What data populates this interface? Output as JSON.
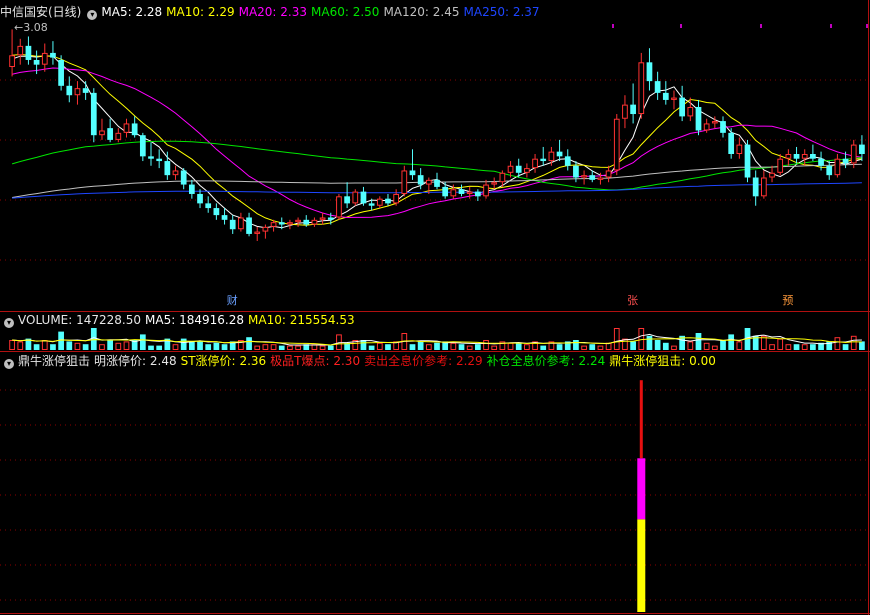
{
  "colors": {
    "background": "#000000",
    "up": "#ff3232",
    "down": "#54ffff",
    "grid": "#8b0000",
    "ma5": "#ffffff",
    "ma10": "#ffff00",
    "ma20": "#ff00ff",
    "ma60": "#00e600",
    "ma120": "#c0c0c0",
    "ma250": "#1e46ff"
  },
  "main": {
    "title": "中信国安(日线)",
    "legend_icon": "chevron-down-icon",
    "ma5_label": "MA5:",
    "ma5_value": "2.28",
    "ma10_label": "MA10:",
    "ma10_value": "2.29",
    "ma20_label": "MA20:",
    "ma20_value": "2.33",
    "ma60_label": "MA60:",
    "ma60_value": "2.50",
    "ma120_label": "MA120:",
    "ma120_value": "2.45",
    "ma250_label": "MA250:",
    "ma250_value": "2.37",
    "high_marker": "3.08",
    "tags": [
      "财",
      "张",
      "预"
    ]
  },
  "volume": {
    "label": "VOLUME:",
    "value": "147228.50",
    "ma5_label": "MA5:",
    "ma5_value": "184916.28",
    "ma10_label": "MA10:",
    "ma10_value": "215554.53"
  },
  "indicator": {
    "name": "鼎牛涨停狙击",
    "f1_label": "明涨停价:",
    "f1_value": "2.48",
    "f2_label": "ST涨停价:",
    "f2_value": "2.36",
    "f3_label": "极品T爆点:",
    "f3_value": "2.30",
    "f4_label": "卖出全息价参考:",
    "f4_value": "2.29",
    "f5_label": "补仓全息价参考:",
    "f5_value": "2.24",
    "f6_label": "鼎牛涨停狙击:",
    "f6_value": "0.00"
  },
  "chart_data": {
    "type": "candlestick",
    "ylim": [
      1.98,
      3.12
    ],
    "price_high_label": 3.08,
    "candles": [
      {
        "o": 2.92,
        "h": 3.08,
        "l": 2.88,
        "c": 2.97
      },
      {
        "o": 2.97,
        "h": 3.04,
        "l": 2.93,
        "c": 3.01
      },
      {
        "o": 3.01,
        "h": 3.05,
        "l": 2.93,
        "c": 2.95
      },
      {
        "o": 2.95,
        "h": 2.99,
        "l": 2.89,
        "c": 2.93
      },
      {
        "o": 2.93,
        "h": 3.02,
        "l": 2.9,
        "c": 2.98
      },
      {
        "o": 2.98,
        "h": 3.03,
        "l": 2.93,
        "c": 2.96
      },
      {
        "o": 2.95,
        "h": 2.97,
        "l": 2.82,
        "c": 2.84
      },
      {
        "o": 2.84,
        "h": 2.88,
        "l": 2.77,
        "c": 2.8
      },
      {
        "o": 2.8,
        "h": 2.86,
        "l": 2.76,
        "c": 2.83
      },
      {
        "o": 2.83,
        "h": 2.86,
        "l": 2.78,
        "c": 2.81
      },
      {
        "o": 2.81,
        "h": 2.83,
        "l": 2.6,
        "c": 2.63
      },
      {
        "o": 2.63,
        "h": 2.7,
        "l": 2.61,
        "c": 2.65
      },
      {
        "o": 2.66,
        "h": 2.7,
        "l": 2.6,
        "c": 2.61
      },
      {
        "o": 2.61,
        "h": 2.66,
        "l": 2.6,
        "c": 2.64
      },
      {
        "o": 2.64,
        "h": 2.7,
        "l": 2.62,
        "c": 2.68
      },
      {
        "o": 2.68,
        "h": 2.71,
        "l": 2.62,
        "c": 2.63
      },
      {
        "o": 2.63,
        "h": 2.64,
        "l": 2.52,
        "c": 2.54
      },
      {
        "o": 2.54,
        "h": 2.6,
        "l": 2.5,
        "c": 2.53
      },
      {
        "o": 2.53,
        "h": 2.57,
        "l": 2.49,
        "c": 2.52
      },
      {
        "o": 2.52,
        "h": 2.56,
        "l": 2.44,
        "c": 2.46
      },
      {
        "o": 2.46,
        "h": 2.5,
        "l": 2.44,
        "c": 2.48
      },
      {
        "o": 2.48,
        "h": 2.49,
        "l": 2.4,
        "c": 2.42
      },
      {
        "o": 2.42,
        "h": 2.44,
        "l": 2.36,
        "c": 2.38
      },
      {
        "o": 2.38,
        "h": 2.4,
        "l": 2.32,
        "c": 2.34
      },
      {
        "o": 2.34,
        "h": 2.37,
        "l": 2.3,
        "c": 2.32
      },
      {
        "o": 2.32,
        "h": 2.34,
        "l": 2.27,
        "c": 2.29
      },
      {
        "o": 2.29,
        "h": 2.32,
        "l": 2.25,
        "c": 2.27
      },
      {
        "o": 2.27,
        "h": 2.29,
        "l": 2.21,
        "c": 2.23
      },
      {
        "o": 2.23,
        "h": 2.3,
        "l": 2.22,
        "c": 2.28
      },
      {
        "o": 2.28,
        "h": 2.3,
        "l": 2.2,
        "c": 2.21
      },
      {
        "o": 2.21,
        "h": 2.24,
        "l": 2.18,
        "c": 2.22
      },
      {
        "o": 2.22,
        "h": 2.25,
        "l": 2.19,
        "c": 2.24
      },
      {
        "o": 2.24,
        "h": 2.27,
        "l": 2.22,
        "c": 2.26
      },
      {
        "o": 2.26,
        "h": 2.28,
        "l": 2.23,
        "c": 2.25
      },
      {
        "o": 2.25,
        "h": 2.27,
        "l": 2.23,
        "c": 2.26
      },
      {
        "o": 2.26,
        "h": 2.28,
        "l": 2.24,
        "c": 2.27
      },
      {
        "o": 2.27,
        "h": 2.29,
        "l": 2.24,
        "c": 2.25
      },
      {
        "o": 2.25,
        "h": 2.28,
        "l": 2.24,
        "c": 2.27
      },
      {
        "o": 2.27,
        "h": 2.3,
        "l": 2.25,
        "c": 2.28
      },
      {
        "o": 2.28,
        "h": 2.3,
        "l": 2.25,
        "c": 2.27
      },
      {
        "o": 2.28,
        "h": 2.38,
        "l": 2.27,
        "c": 2.37
      },
      {
        "o": 2.37,
        "h": 2.43,
        "l": 2.32,
        "c": 2.34
      },
      {
        "o": 2.34,
        "h": 2.4,
        "l": 2.33,
        "c": 2.39
      },
      {
        "o": 2.39,
        "h": 2.41,
        "l": 2.33,
        "c": 2.34
      },
      {
        "o": 2.34,
        "h": 2.36,
        "l": 2.31,
        "c": 2.33
      },
      {
        "o": 2.33,
        "h": 2.37,
        "l": 2.32,
        "c": 2.36
      },
      {
        "o": 2.36,
        "h": 2.38,
        "l": 2.33,
        "c": 2.34
      },
      {
        "o": 2.34,
        "h": 2.4,
        "l": 2.33,
        "c": 2.38
      },
      {
        "o": 2.38,
        "h": 2.5,
        "l": 2.37,
        "c": 2.48
      },
      {
        "o": 2.48,
        "h": 2.57,
        "l": 2.44,
        "c": 2.46
      },
      {
        "o": 2.46,
        "h": 2.49,
        "l": 2.4,
        "c": 2.42
      },
      {
        "o": 2.42,
        "h": 2.45,
        "l": 2.38,
        "c": 2.44
      },
      {
        "o": 2.44,
        "h": 2.47,
        "l": 2.4,
        "c": 2.41
      },
      {
        "o": 2.41,
        "h": 2.43,
        "l": 2.36,
        "c": 2.37
      },
      {
        "o": 2.37,
        "h": 2.42,
        "l": 2.36,
        "c": 2.4
      },
      {
        "o": 2.4,
        "h": 2.42,
        "l": 2.37,
        "c": 2.38
      },
      {
        "o": 2.38,
        "h": 2.41,
        "l": 2.36,
        "c": 2.39
      },
      {
        "o": 2.39,
        "h": 2.4,
        "l": 2.35,
        "c": 2.37
      },
      {
        "o": 2.37,
        "h": 2.44,
        "l": 2.36,
        "c": 2.42
      },
      {
        "o": 2.42,
        "h": 2.45,
        "l": 2.4,
        "c": 2.43
      },
      {
        "o": 2.43,
        "h": 2.48,
        "l": 2.41,
        "c": 2.47
      },
      {
        "o": 2.47,
        "h": 2.52,
        "l": 2.45,
        "c": 2.5
      },
      {
        "o": 2.5,
        "h": 2.53,
        "l": 2.45,
        "c": 2.47
      },
      {
        "o": 2.47,
        "h": 2.51,
        "l": 2.45,
        "c": 2.49
      },
      {
        "o": 2.49,
        "h": 2.55,
        "l": 2.47,
        "c": 2.53
      },
      {
        "o": 2.53,
        "h": 2.58,
        "l": 2.5,
        "c": 2.52
      },
      {
        "o": 2.52,
        "h": 2.58,
        "l": 2.5,
        "c": 2.56
      },
      {
        "o": 2.56,
        "h": 2.61,
        "l": 2.52,
        "c": 2.54
      },
      {
        "o": 2.54,
        "h": 2.57,
        "l": 2.48,
        "c": 2.5
      },
      {
        "o": 2.5,
        "h": 2.52,
        "l": 2.43,
        "c": 2.45
      },
      {
        "o": 2.45,
        "h": 2.48,
        "l": 2.42,
        "c": 2.46
      },
      {
        "o": 2.46,
        "h": 2.48,
        "l": 2.43,
        "c": 2.44
      },
      {
        "o": 2.44,
        "h": 2.47,
        "l": 2.42,
        "c": 2.45
      },
      {
        "o": 2.45,
        "h": 2.5,
        "l": 2.43,
        "c": 2.48
      },
      {
        "o": 2.48,
        "h": 2.72,
        "l": 2.46,
        "c": 2.7
      },
      {
        "o": 2.7,
        "h": 2.8,
        "l": 2.66,
        "c": 2.76
      },
      {
        "o": 2.76,
        "h": 2.85,
        "l": 2.68,
        "c": 2.72
      },
      {
        "o": 2.72,
        "h": 2.98,
        "l": 2.7,
        "c": 2.94
      },
      {
        "o": 2.94,
        "h": 3.0,
        "l": 2.82,
        "c": 2.86
      },
      {
        "o": 2.86,
        "h": 2.9,
        "l": 2.78,
        "c": 2.81
      },
      {
        "o": 2.81,
        "h": 2.86,
        "l": 2.76,
        "c": 2.78
      },
      {
        "o": 2.78,
        "h": 2.82,
        "l": 2.74,
        "c": 2.79
      },
      {
        "o": 2.79,
        "h": 2.84,
        "l": 2.69,
        "c": 2.71
      },
      {
        "o": 2.71,
        "h": 2.79,
        "l": 2.69,
        "c": 2.75
      },
      {
        "o": 2.75,
        "h": 2.78,
        "l": 2.63,
        "c": 2.65
      },
      {
        "o": 2.65,
        "h": 2.7,
        "l": 2.64,
        "c": 2.68
      },
      {
        "o": 2.68,
        "h": 2.71,
        "l": 2.66,
        "c": 2.69
      },
      {
        "o": 2.69,
        "h": 2.71,
        "l": 2.62,
        "c": 2.64
      },
      {
        "o": 2.64,
        "h": 2.66,
        "l": 2.53,
        "c": 2.55
      },
      {
        "o": 2.55,
        "h": 2.62,
        "l": 2.53,
        "c": 2.59
      },
      {
        "o": 2.59,
        "h": 2.61,
        "l": 2.43,
        "c": 2.45
      },
      {
        "o": 2.45,
        "h": 2.48,
        "l": 2.33,
        "c": 2.37
      },
      {
        "o": 2.37,
        "h": 2.48,
        "l": 2.36,
        "c": 2.45
      },
      {
        "o": 2.45,
        "h": 2.5,
        "l": 2.43,
        "c": 2.47
      },
      {
        "o": 2.47,
        "h": 2.55,
        "l": 2.46,
        "c": 2.53
      },
      {
        "o": 2.53,
        "h": 2.57,
        "l": 2.5,
        "c": 2.55
      },
      {
        "o": 2.55,
        "h": 2.58,
        "l": 2.51,
        "c": 2.53
      },
      {
        "o": 2.53,
        "h": 2.57,
        "l": 2.5,
        "c": 2.55
      },
      {
        "o": 2.55,
        "h": 2.59,
        "l": 2.52,
        "c": 2.53
      },
      {
        "o": 2.53,
        "h": 2.56,
        "l": 2.48,
        "c": 2.5
      },
      {
        "o": 2.5,
        "h": 2.52,
        "l": 2.44,
        "c": 2.46
      },
      {
        "o": 2.46,
        "h": 2.55,
        "l": 2.45,
        "c": 2.53
      },
      {
        "o": 2.53,
        "h": 2.56,
        "l": 2.49,
        "c": 2.51
      },
      {
        "o": 2.51,
        "h": 2.61,
        "l": 2.49,
        "c": 2.59
      },
      {
        "o": 2.59,
        "h": 2.63,
        "l": 2.52,
        "c": 2.55
      }
    ],
    "indicator_bar": {
      "index": 77,
      "segments": [
        {
          "from": 0,
          "to": 0.38,
          "color": "#ffff00"
        },
        {
          "from": 0.38,
          "to": 0.63,
          "color": "#ff00ff"
        },
        {
          "from": 0.63,
          "to": 0.95,
          "color": "#e61010"
        }
      ]
    },
    "tag_positions": [
      {
        "index": 27,
        "tag": "财"
      },
      {
        "index": 76,
        "tag": "张"
      },
      {
        "index": 95,
        "tag": "预"
      }
    ]
  }
}
